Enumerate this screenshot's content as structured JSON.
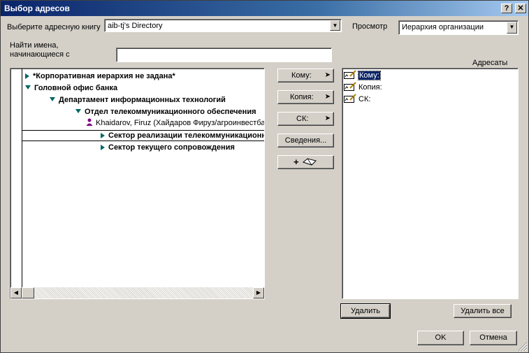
{
  "title": "Выбор адресов",
  "title_buttons": {
    "help": "?",
    "close": "✕"
  },
  "address_book": {
    "label": "Выберите адресную книгу",
    "value": "aib-tj's Directory"
  },
  "view": {
    "label": "Просмотр",
    "value": "Иерархия организации"
  },
  "search": {
    "label_line1": "Найти имена,",
    "label_line2": "начинающиеся с",
    "value": ""
  },
  "recipients_label": "Адресаты",
  "tree": [
    {
      "text": "*Корпоративная иерархия не задана*",
      "expander": "collapsed",
      "bold": true,
      "person": false
    },
    {
      "text": "Головной офис банка",
      "expander": "expanded",
      "bold": true,
      "person": false
    },
    {
      "text": "Департамент информационных технологий",
      "expander": "expanded",
      "bold": true,
      "person": false
    },
    {
      "text": "Отдел телекоммуникационного обеспечения",
      "expander": "expanded",
      "bold": true,
      "person": false
    },
    {
      "text": "Khaidarov, Firuz (Хайдаров Фируз/агроинвестбанк)",
      "expander": "none",
      "bold": false,
      "person": true
    },
    {
      "text": "Сектор реализации телекоммуникационных",
      "expander": "collapsed",
      "bold": true,
      "person": false,
      "selected": true
    },
    {
      "text": "Сектор текущего сопровождения",
      "expander": "collapsed",
      "bold": true,
      "person": false
    }
  ],
  "action_buttons": {
    "to": "Кому:",
    "cc": "Копия:",
    "bcc": "СК:",
    "details": "Сведения...",
    "add": "+"
  },
  "recipients": [
    {
      "label": "Кому:",
      "selected": true
    },
    {
      "label": "Копия:",
      "selected": false
    },
    {
      "label": "СК:",
      "selected": false
    }
  ],
  "remove_button": "Удалить",
  "remove_all_button": "Удалить все",
  "ok_button": "OK",
  "cancel_button": "Отмена",
  "icons": {
    "arrow": "arrow-right-icon",
    "book": "address-book-icon",
    "person": "person-icon",
    "recipient": "recipient-field-icon"
  }
}
